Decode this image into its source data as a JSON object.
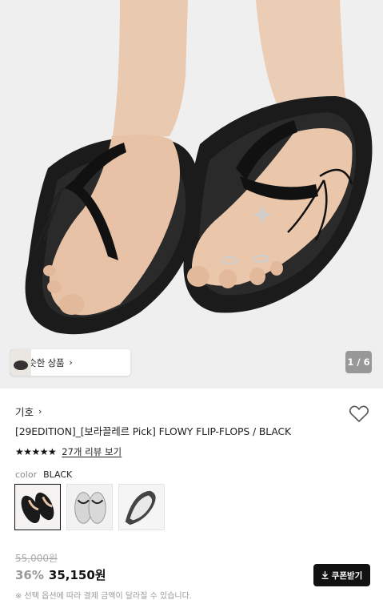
{
  "gallery": {
    "image_alt": "black flip-flops worn on feet",
    "similar_label": "비슷한 상품",
    "counter": "1 / 6"
  },
  "product": {
    "brand": "기호",
    "title": "[29EDITION]_[보라끌레르 Pick] FLOWY FLIP-FLOPS / BLACK",
    "stars": "★★★★★",
    "review_link": "27개 리뷰 보기",
    "color_label": "color",
    "color_value": "BLACK",
    "swatches": [
      "black",
      "white",
      "white-gray"
    ],
    "selected_swatch": 0
  },
  "pricing": {
    "original": "55,000원",
    "discount": "36%",
    "sale": "35,150원",
    "coupon_label": "쿠폰받기",
    "note": "※ 선택 옵션에 따라 결제 금액이 달라질 수 있습니다."
  },
  "icons": {
    "wishlist": "heart-outline-icon",
    "coupon": "download-icon",
    "chevron": "chevron-right-icon"
  },
  "colors": {
    "accent": "#111111",
    "muted": "#999999",
    "background": "#f1f1f1"
  }
}
